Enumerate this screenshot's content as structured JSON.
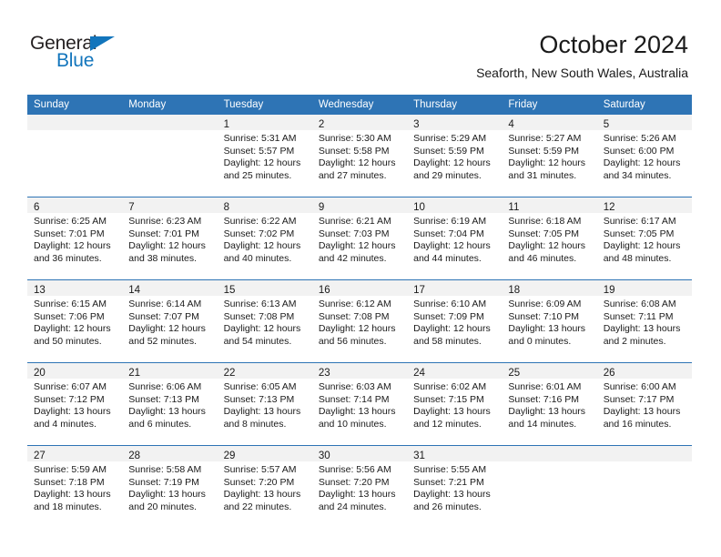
{
  "brand": {
    "name_part1": "General",
    "name_part2": "Blue",
    "accent_color": "#1275bc"
  },
  "header": {
    "title": "October 2024",
    "subtitle": "Seaforth, New South Wales, Australia",
    "header_bg_color": "#2e74b5",
    "daynum_strip_color": "#f2f2f2"
  },
  "weekdays": [
    "Sunday",
    "Monday",
    "Tuesday",
    "Wednesday",
    "Thursday",
    "Friday",
    "Saturday"
  ],
  "weeks": [
    [
      {
        "day": "",
        "sunrise": "",
        "sunset": "",
        "daylight_line1": "",
        "daylight_line2": "",
        "empty": true
      },
      {
        "day": "",
        "sunrise": "",
        "sunset": "",
        "daylight_line1": "",
        "daylight_line2": "",
        "empty": true
      },
      {
        "day": "1",
        "sunrise": "Sunrise: 5:31 AM",
        "sunset": "Sunset: 5:57 PM",
        "daylight_line1": "Daylight: 12 hours",
        "daylight_line2": "and 25 minutes."
      },
      {
        "day": "2",
        "sunrise": "Sunrise: 5:30 AM",
        "sunset": "Sunset: 5:58 PM",
        "daylight_line1": "Daylight: 12 hours",
        "daylight_line2": "and 27 minutes."
      },
      {
        "day": "3",
        "sunrise": "Sunrise: 5:29 AM",
        "sunset": "Sunset: 5:59 PM",
        "daylight_line1": "Daylight: 12 hours",
        "daylight_line2": "and 29 minutes."
      },
      {
        "day": "4",
        "sunrise": "Sunrise: 5:27 AM",
        "sunset": "Sunset: 5:59 PM",
        "daylight_line1": "Daylight: 12 hours",
        "daylight_line2": "and 31 minutes."
      },
      {
        "day": "5",
        "sunrise": "Sunrise: 5:26 AM",
        "sunset": "Sunset: 6:00 PM",
        "daylight_line1": "Daylight: 12 hours",
        "daylight_line2": "and 34 minutes."
      }
    ],
    [
      {
        "day": "6",
        "sunrise": "Sunrise: 6:25 AM",
        "sunset": "Sunset: 7:01 PM",
        "daylight_line1": "Daylight: 12 hours",
        "daylight_line2": "and 36 minutes."
      },
      {
        "day": "7",
        "sunrise": "Sunrise: 6:23 AM",
        "sunset": "Sunset: 7:01 PM",
        "daylight_line1": "Daylight: 12 hours",
        "daylight_line2": "and 38 minutes."
      },
      {
        "day": "8",
        "sunrise": "Sunrise: 6:22 AM",
        "sunset": "Sunset: 7:02 PM",
        "daylight_line1": "Daylight: 12 hours",
        "daylight_line2": "and 40 minutes."
      },
      {
        "day": "9",
        "sunrise": "Sunrise: 6:21 AM",
        "sunset": "Sunset: 7:03 PM",
        "daylight_line1": "Daylight: 12 hours",
        "daylight_line2": "and 42 minutes."
      },
      {
        "day": "10",
        "sunrise": "Sunrise: 6:19 AM",
        "sunset": "Sunset: 7:04 PM",
        "daylight_line1": "Daylight: 12 hours",
        "daylight_line2": "and 44 minutes."
      },
      {
        "day": "11",
        "sunrise": "Sunrise: 6:18 AM",
        "sunset": "Sunset: 7:05 PM",
        "daylight_line1": "Daylight: 12 hours",
        "daylight_line2": "and 46 minutes."
      },
      {
        "day": "12",
        "sunrise": "Sunrise: 6:17 AM",
        "sunset": "Sunset: 7:05 PM",
        "daylight_line1": "Daylight: 12 hours",
        "daylight_line2": "and 48 minutes."
      }
    ],
    [
      {
        "day": "13",
        "sunrise": "Sunrise: 6:15 AM",
        "sunset": "Sunset: 7:06 PM",
        "daylight_line1": "Daylight: 12 hours",
        "daylight_line2": "and 50 minutes."
      },
      {
        "day": "14",
        "sunrise": "Sunrise: 6:14 AM",
        "sunset": "Sunset: 7:07 PM",
        "daylight_line1": "Daylight: 12 hours",
        "daylight_line2": "and 52 minutes."
      },
      {
        "day": "15",
        "sunrise": "Sunrise: 6:13 AM",
        "sunset": "Sunset: 7:08 PM",
        "daylight_line1": "Daylight: 12 hours",
        "daylight_line2": "and 54 minutes."
      },
      {
        "day": "16",
        "sunrise": "Sunrise: 6:12 AM",
        "sunset": "Sunset: 7:08 PM",
        "daylight_line1": "Daylight: 12 hours",
        "daylight_line2": "and 56 minutes."
      },
      {
        "day": "17",
        "sunrise": "Sunrise: 6:10 AM",
        "sunset": "Sunset: 7:09 PM",
        "daylight_line1": "Daylight: 12 hours",
        "daylight_line2": "and 58 minutes."
      },
      {
        "day": "18",
        "sunrise": "Sunrise: 6:09 AM",
        "sunset": "Sunset: 7:10 PM",
        "daylight_line1": "Daylight: 13 hours",
        "daylight_line2": "and 0 minutes."
      },
      {
        "day": "19",
        "sunrise": "Sunrise: 6:08 AM",
        "sunset": "Sunset: 7:11 PM",
        "daylight_line1": "Daylight: 13 hours",
        "daylight_line2": "and 2 minutes."
      }
    ],
    [
      {
        "day": "20",
        "sunrise": "Sunrise: 6:07 AM",
        "sunset": "Sunset: 7:12 PM",
        "daylight_line1": "Daylight: 13 hours",
        "daylight_line2": "and 4 minutes."
      },
      {
        "day": "21",
        "sunrise": "Sunrise: 6:06 AM",
        "sunset": "Sunset: 7:13 PM",
        "daylight_line1": "Daylight: 13 hours",
        "daylight_line2": "and 6 minutes."
      },
      {
        "day": "22",
        "sunrise": "Sunrise: 6:05 AM",
        "sunset": "Sunset: 7:13 PM",
        "daylight_line1": "Daylight: 13 hours",
        "daylight_line2": "and 8 minutes."
      },
      {
        "day": "23",
        "sunrise": "Sunrise: 6:03 AM",
        "sunset": "Sunset: 7:14 PM",
        "daylight_line1": "Daylight: 13 hours",
        "daylight_line2": "and 10 minutes."
      },
      {
        "day": "24",
        "sunrise": "Sunrise: 6:02 AM",
        "sunset": "Sunset: 7:15 PM",
        "daylight_line1": "Daylight: 13 hours",
        "daylight_line2": "and 12 minutes."
      },
      {
        "day": "25",
        "sunrise": "Sunrise: 6:01 AM",
        "sunset": "Sunset: 7:16 PM",
        "daylight_line1": "Daylight: 13 hours",
        "daylight_line2": "and 14 minutes."
      },
      {
        "day": "26",
        "sunrise": "Sunrise: 6:00 AM",
        "sunset": "Sunset: 7:17 PM",
        "daylight_line1": "Daylight: 13 hours",
        "daylight_line2": "and 16 minutes."
      }
    ],
    [
      {
        "day": "27",
        "sunrise": "Sunrise: 5:59 AM",
        "sunset": "Sunset: 7:18 PM",
        "daylight_line1": "Daylight: 13 hours",
        "daylight_line2": "and 18 minutes."
      },
      {
        "day": "28",
        "sunrise": "Sunrise: 5:58 AM",
        "sunset": "Sunset: 7:19 PM",
        "daylight_line1": "Daylight: 13 hours",
        "daylight_line2": "and 20 minutes."
      },
      {
        "day": "29",
        "sunrise": "Sunrise: 5:57 AM",
        "sunset": "Sunset: 7:20 PM",
        "daylight_line1": "Daylight: 13 hours",
        "daylight_line2": "and 22 minutes."
      },
      {
        "day": "30",
        "sunrise": "Sunrise: 5:56 AM",
        "sunset": "Sunset: 7:20 PM",
        "daylight_line1": "Daylight: 13 hours",
        "daylight_line2": "and 24 minutes."
      },
      {
        "day": "31",
        "sunrise": "Sunrise: 5:55 AM",
        "sunset": "Sunset: 7:21 PM",
        "daylight_line1": "Daylight: 13 hours",
        "daylight_line2": "and 26 minutes."
      },
      {
        "day": "",
        "sunrise": "",
        "sunset": "",
        "daylight_line1": "",
        "daylight_line2": "",
        "empty": true
      },
      {
        "day": "",
        "sunrise": "",
        "sunset": "",
        "daylight_line1": "",
        "daylight_line2": "",
        "empty": true
      }
    ]
  ]
}
